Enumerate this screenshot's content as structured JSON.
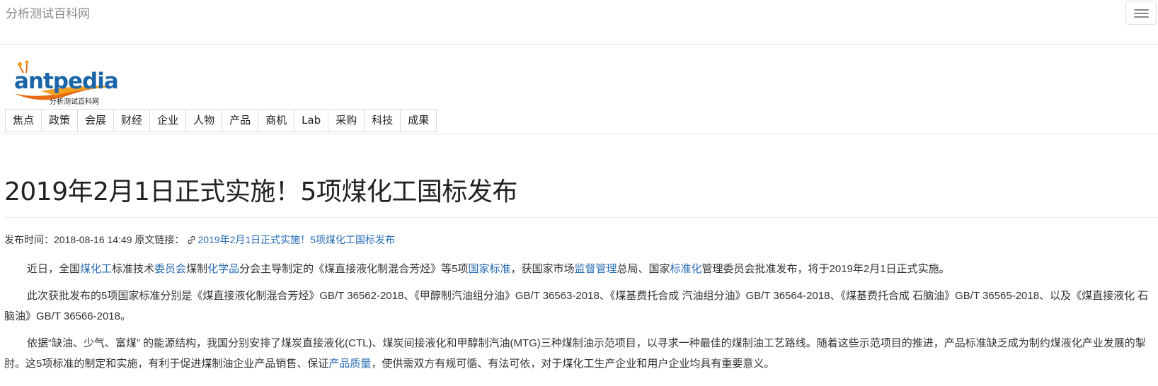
{
  "topbar": {
    "brand": "分析测试百科网"
  },
  "logo": {
    "wordmark": "antpedia",
    "subtitle": "分析测试百科网"
  },
  "nav": [
    "焦点",
    "政策",
    "会展",
    "财经",
    "企业",
    "人物",
    "产品",
    "商机",
    "Lab",
    "采购",
    "科技",
    "成果"
  ],
  "article": {
    "title": "2019年2月1日正式实施！5项煤化工国标发布",
    "meta": {
      "published_label": "发布时间：",
      "published_time": "2018-08-16 14:49",
      "source_label": "原文链接：",
      "source_link": "2019年2月1日正式实施！5项煤化工国标发布"
    },
    "paragraphs": [
      [
        {
          "t": "近日，全国"
        },
        {
          "t": "煤化工",
          "k": true
        },
        {
          "t": "标准技术"
        },
        {
          "t": "委员会",
          "k": true
        },
        {
          "t": "煤制"
        },
        {
          "t": "化学品",
          "k": true
        },
        {
          "t": "分会主导制定的《煤直接液化制混合芳烃》等5项"
        },
        {
          "t": "国家标准",
          "k": true
        },
        {
          "t": "，获国家市场"
        },
        {
          "t": "监督管理",
          "k": true
        },
        {
          "t": "总局、国家"
        },
        {
          "t": "标准化",
          "k": true
        },
        {
          "t": "管理委员会批准发布，将于2019年2月1日正式实施。"
        }
      ],
      [
        {
          "t": "此次获批发布的5项国家标准分别是《煤直接液化制混合芳烃》GB/T 36562-2018、《甲醇制汽油组分油》GB/T 36563-2018、《煤基费托合成 汽油组分油》GB/T 36564-2018、《煤基费托合成 石脑油》GB/T 36565-2018、以及《煤直接液化 石脑油》GB/T 36566-2018。"
        }
      ],
      [
        {
          "t": "依据“缺油、少气、富煤” 的能源结构，我国分别安排了煤炭直接液化(CTL)、煤炭间接液化和甲醇制汽油(MTG)三种煤制油示范项目，以寻求一种最佳的煤制油工艺路线。随着这些示范项目的推进，产品标准缺乏成为制约煤液化产业发展的掣肘。这5项标准的制定和实施，有利于促进煤制油企业产品销售、保证"
        },
        {
          "t": "产品质量",
          "k": true
        },
        {
          "t": "，使供需双方有规可循、有法可依，对于煤化工生产企业和用户企业均具有重要意义。"
        }
      ]
    ]
  }
}
